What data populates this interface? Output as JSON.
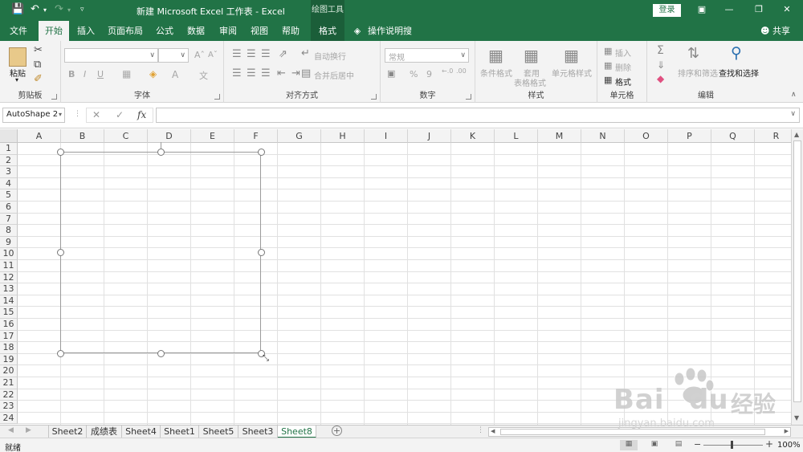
{
  "titlebar": {
    "title": "新建 Microsoft Excel 工作表  -  Excel",
    "context_title": "绘图工具",
    "login": "登录"
  },
  "tabs": [
    {
      "label": "文件"
    },
    {
      "label": "开始"
    },
    {
      "label": "插入"
    },
    {
      "label": "页面布局"
    },
    {
      "label": "公式"
    },
    {
      "label": "数据"
    },
    {
      "label": "审阅"
    },
    {
      "label": "视图"
    },
    {
      "label": "帮助"
    },
    {
      "label": "格式"
    }
  ],
  "tellme": "操作说明搜索",
  "share": "共享",
  "ribbon": {
    "clipboard": {
      "paste": "粘贴",
      "label": "剪贴板"
    },
    "font": {
      "label": "字体",
      "bold": "B",
      "italic": "I",
      "underline": "U"
    },
    "alignment": {
      "wrap": "自动换行",
      "merge": "合并后居中",
      "label": "对齐方式"
    },
    "number": {
      "format": "常规",
      "percent": "%",
      "comma": "9",
      "label": "数字"
    },
    "styles": {
      "conditional": "条件格式",
      "table1": "套用",
      "table2": "表格格式",
      "cell": "单元格样式",
      "label": "样式"
    },
    "cells": {
      "insert": "插入",
      "delete": "删除",
      "format": "格式",
      "label": "单元格"
    },
    "editing": {
      "sort": "排序和筛选",
      "find": "查找和选择",
      "label": "编辑"
    }
  },
  "formula_bar": {
    "name_box": "AutoShape 2",
    "fx": "fx",
    "value": ""
  },
  "columns": [
    "A",
    "B",
    "C",
    "D",
    "E",
    "F",
    "G",
    "H",
    "I",
    "J",
    "K",
    "L",
    "M",
    "N",
    "O",
    "P",
    "Q",
    "R"
  ],
  "rows": [
    "1",
    "2",
    "3",
    "4",
    "5",
    "6",
    "7",
    "8",
    "9",
    "10",
    "11",
    "12",
    "13",
    "14",
    "15",
    "16",
    "17",
    "18",
    "19",
    "20",
    "21",
    "22",
    "23",
    "24"
  ],
  "sheets": [
    {
      "label": "Sheet2"
    },
    {
      "label": "成绩表"
    },
    {
      "label": "Sheet4"
    },
    {
      "label": "Sheet1"
    },
    {
      "label": "Sheet5"
    },
    {
      "label": "Sheet3"
    },
    {
      "label": "Sheet8"
    }
  ],
  "add_sheet": "+",
  "status": {
    "ready": "就绪",
    "zoom": "100%"
  },
  "watermark": {
    "brand": "Bai",
    "brand2": "du",
    "cn": "经验",
    "url": "jingyan.baidu.com"
  },
  "colors": {
    "accent": "#217346"
  }
}
